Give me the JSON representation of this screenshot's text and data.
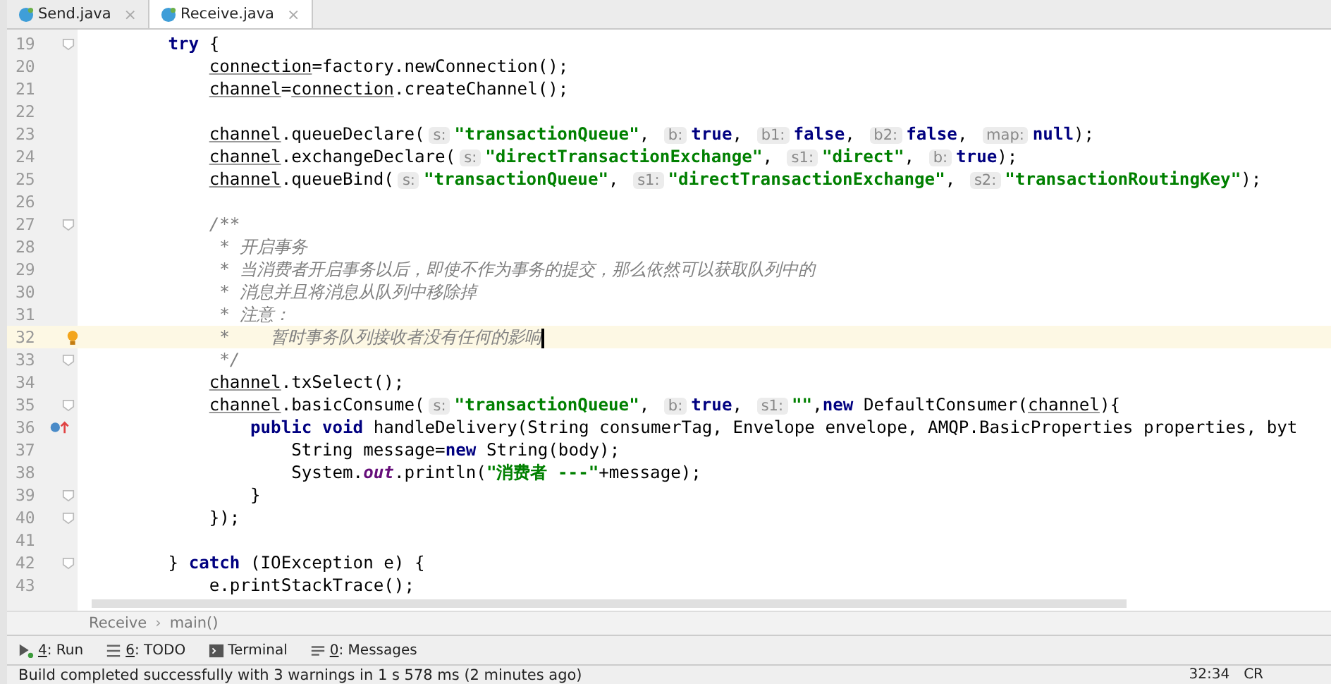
{
  "tabs": [
    {
      "label": "Send.java",
      "close": "×",
      "selected": false
    },
    {
      "label": "Receive.java",
      "close": "×",
      "selected": true
    }
  ],
  "editor": {
    "lines": [
      {
        "number": "19",
        "current": false,
        "kind": "fold",
        "tokens": [
          {
            "kind": "kw",
            "text": "        try"
          },
          {
            "kind": "plain",
            "text": " {"
          }
        ]
      },
      {
        "number": "20",
        "current": false,
        "kind": "plain",
        "tokens": [
          {
            "kind": "var",
            "text": "            connection"
          },
          {
            "kind": "plain",
            "text": "=factory.newConnection();"
          }
        ]
      },
      {
        "number": "21",
        "current": false,
        "kind": "plain",
        "tokens": [
          {
            "kind": "var",
            "text": "            channel"
          },
          {
            "kind": "plain",
            "text": "="
          },
          {
            "kind": "var",
            "text": "connection"
          },
          {
            "kind": "plain",
            "text": ".createChannel();"
          }
        ]
      },
      {
        "number": "22",
        "current": false,
        "kind": "plain"
      },
      {
        "number": "23",
        "current": false,
        "kind": "plain",
        "tokens": [
          {
            "kind": "var",
            "text": "            channel"
          },
          {
            "kind": "plain",
            "text": ".queueDeclare("
          },
          {
            "kind": "hint",
            "text": "s:"
          },
          {
            "kind": "str",
            "text": "\"transactionQueue\""
          },
          {
            "kind": "plain",
            "text": ", "
          },
          {
            "kind": "hint",
            "text": "b:"
          },
          {
            "kind": "kw",
            "text": "true"
          },
          {
            "kind": "plain",
            "text": ", "
          },
          {
            "kind": "hint",
            "text": "b1:"
          },
          {
            "kind": "kw",
            "text": "false"
          },
          {
            "kind": "plain",
            "text": ", "
          },
          {
            "kind": "hint",
            "text": "b2:"
          },
          {
            "kind": "kw",
            "text": "false"
          },
          {
            "kind": "plain",
            "text": ", "
          },
          {
            "kind": "hint",
            "text": "map:"
          },
          {
            "kind": "kw",
            "text": "null"
          },
          {
            "kind": "plain",
            "text": ");"
          }
        ]
      },
      {
        "number": "24",
        "current": false,
        "kind": "plain",
        "tokens": [
          {
            "kind": "var",
            "text": "            channel"
          },
          {
            "kind": "plain",
            "text": ".exchangeDeclare("
          },
          {
            "kind": "hint",
            "text": "s:"
          },
          {
            "kind": "str",
            "text": "\"directTransactionExchange\""
          },
          {
            "kind": "plain",
            "text": ", "
          },
          {
            "kind": "hint",
            "text": "s1:"
          },
          {
            "kind": "str",
            "text": "\"direct\""
          },
          {
            "kind": "plain",
            "text": ", "
          },
          {
            "kind": "hint",
            "text": "b:"
          },
          {
            "kind": "kw",
            "text": "true"
          },
          {
            "kind": "plain",
            "text": ");"
          }
        ]
      },
      {
        "number": "25",
        "current": false,
        "kind": "plain",
        "tokens": [
          {
            "kind": "var",
            "text": "            channel"
          },
          {
            "kind": "plain",
            "text": ".queueBind("
          },
          {
            "kind": "hint",
            "text": "s:"
          },
          {
            "kind": "str",
            "text": "\"transactionQueue\""
          },
          {
            "kind": "plain",
            "text": ", "
          },
          {
            "kind": "hint",
            "text": "s1:"
          },
          {
            "kind": "str",
            "text": "\"directTransactionExchange\""
          },
          {
            "kind": "plain",
            "text": ", "
          },
          {
            "kind": "hint",
            "text": "s2:"
          },
          {
            "kind": "str",
            "text": "\"transactionRoutingKey\""
          },
          {
            "kind": "plain",
            "text": ");"
          }
        ]
      },
      {
        "number": "26",
        "current": false,
        "kind": "plain"
      },
      {
        "number": "27",
        "current": false,
        "kind": "fold",
        "tokens": [
          {
            "kind": "comment",
            "text": "            /**"
          }
        ]
      },
      {
        "number": "28",
        "current": false,
        "kind": "plain",
        "tokens": [
          {
            "kind": "comment",
            "text": "             * 开启事务"
          }
        ]
      },
      {
        "number": "29",
        "current": false,
        "kind": "plain",
        "tokens": [
          {
            "kind": "comment",
            "text": "             * 当消费者开启事务以后，即使不作为事务的提交，那么依然可以获取队列中的"
          }
        ]
      },
      {
        "number": "30",
        "current": false,
        "kind": "plain",
        "tokens": [
          {
            "kind": "comment",
            "text": "             * 消息并且将消息从队列中移除掉"
          }
        ]
      },
      {
        "number": "31",
        "current": false,
        "kind": "plain",
        "tokens": [
          {
            "kind": "comment",
            "text": "             * 注意："
          }
        ]
      },
      {
        "number": "32",
        "current": true,
        "kind": "bulb",
        "tokens": [
          {
            "kind": "comment",
            "text": "             *    暂时事务队列接收者没有任何的影响"
          }
        ]
      },
      {
        "number": "33",
        "current": false,
        "kind": "fold",
        "tokens": [
          {
            "kind": "comment",
            "text": "             */"
          }
        ]
      },
      {
        "number": "34",
        "current": false,
        "kind": "plain",
        "tokens": [
          {
            "kind": "var",
            "text": "            channel"
          },
          {
            "kind": "plain",
            "text": ".txSelect();"
          }
        ]
      },
      {
        "number": "35",
        "current": false,
        "kind": "fold",
        "tokens": [
          {
            "kind": "var",
            "text": "            channel"
          },
          {
            "kind": "plain",
            "text": ".basicConsume("
          },
          {
            "kind": "hint",
            "text": "s:"
          },
          {
            "kind": "str",
            "text": "\"transactionQueue\""
          },
          {
            "kind": "plain",
            "text": ", "
          },
          {
            "kind": "hint",
            "text": "b:"
          },
          {
            "kind": "kw",
            "text": "true"
          },
          {
            "kind": "plain",
            "text": ", "
          },
          {
            "kind": "hint",
            "text": "s1:"
          },
          {
            "kind": "str",
            "text": "\"\""
          },
          {
            "kind": "plain",
            "text": ","
          },
          {
            "kind": "kw",
            "text": "new"
          },
          {
            "kind": "plain",
            "text": " DefaultConsumer("
          },
          {
            "kind": "var",
            "text": "channel"
          },
          {
            "kind": "plain",
            "text": "){"
          }
        ]
      },
      {
        "number": "36",
        "current": false,
        "kind": "override",
        "tokens": [
          {
            "kind": "kw",
            "text": "                public void"
          },
          {
            "kind": "plain",
            "text": " handleDelivery(String consumerTag, Envelope envelope, AMQP.BasicProperties properties, byt"
          }
        ]
      },
      {
        "number": "37",
        "current": false,
        "kind": "plain",
        "tokens": [
          {
            "kind": "plain",
            "text": "                    String message="
          },
          {
            "kind": "kw",
            "text": "new"
          },
          {
            "kind": "plain",
            "text": " String(body);"
          }
        ]
      },
      {
        "number": "38",
        "current": false,
        "kind": "plain",
        "tokens": [
          {
            "kind": "plain",
            "text": "                    System."
          },
          {
            "kind": "static",
            "text": "out"
          },
          {
            "kind": "plain",
            "text": ".println("
          },
          {
            "kind": "str",
            "text": "\"消费者 ---\""
          },
          {
            "kind": "plain",
            "text": "+message);"
          }
        ]
      },
      {
        "number": "39",
        "current": false,
        "kind": "fold",
        "tokens": [
          {
            "kind": "plain",
            "text": "                }"
          }
        ]
      },
      {
        "number": "40",
        "current": false,
        "kind": "fold",
        "tokens": [
          {
            "kind": "plain",
            "text": "            });"
          }
        ]
      },
      {
        "number": "41",
        "current": false,
        "kind": "plain"
      },
      {
        "number": "42",
        "current": false,
        "kind": "fold",
        "tokens": [
          {
            "kind": "plain",
            "text": "        } "
          },
          {
            "kind": "kw",
            "text": "catch"
          },
          {
            "kind": "plain",
            "text": " (IOException e) {"
          }
        ]
      },
      {
        "number": "43",
        "current": false,
        "kind": "plain",
        "tokens": [
          {
            "kind": "plain",
            "text": "            e.printStackTrace();"
          }
        ]
      }
    ]
  },
  "breadcrumb": {
    "items": [
      "Receive",
      "main()"
    ],
    "separator": "›"
  },
  "tool_windows": [
    {
      "kind": "run",
      "mnemonic": "4",
      "label": ": Run"
    },
    {
      "kind": "todo",
      "mnemonic": "6",
      "label": ": TODO"
    },
    {
      "kind": "terminal",
      "label": "Terminal"
    },
    {
      "kind": "messages",
      "mnemonic": "0",
      "label": ": Messages"
    }
  ],
  "status_bar": {
    "message": "Build completed successfully with 3 warnings in 1 s 578 ms (2 minutes ago)",
    "position": "32:34",
    "line_separator": "CR"
  }
}
